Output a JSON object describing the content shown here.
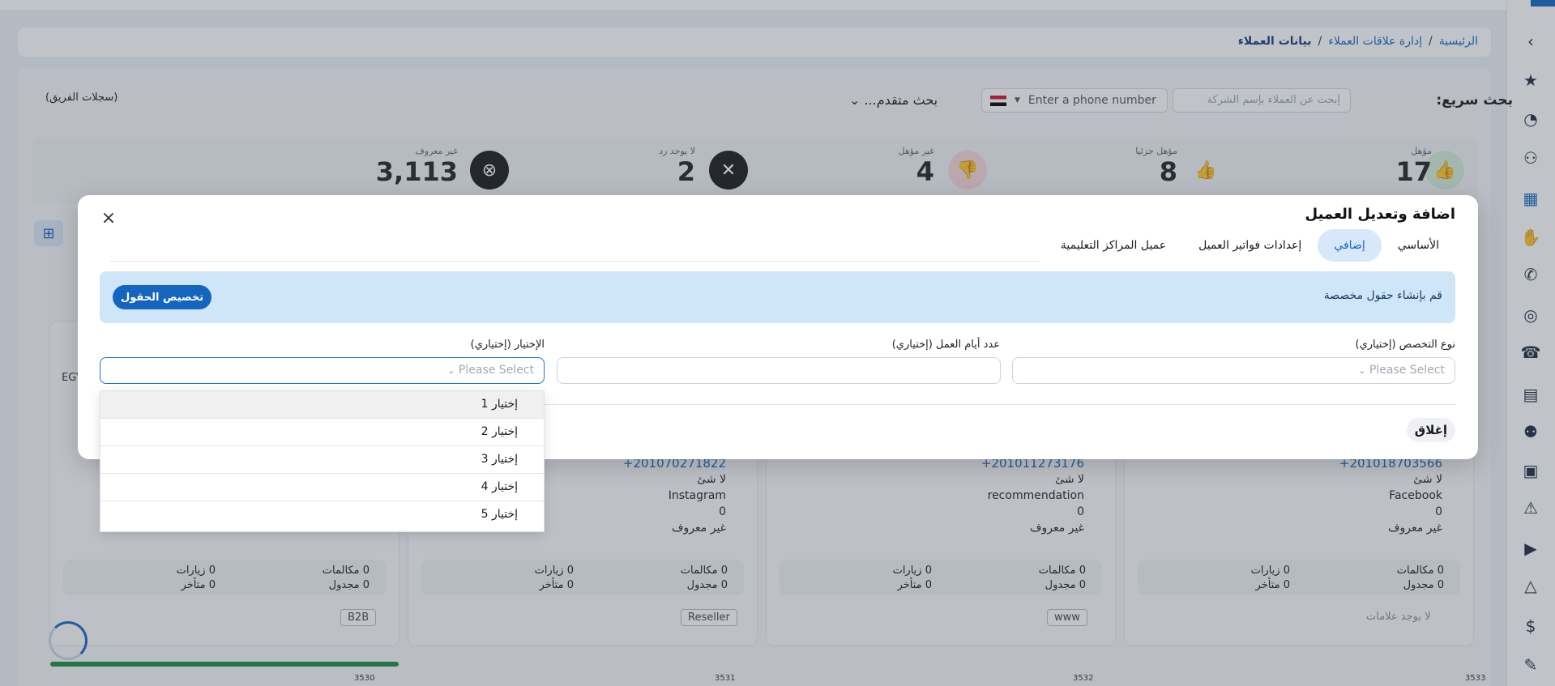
{
  "breadcrumb": {
    "home": "الرئيسية",
    "section": "إدارة علاقات العملاء",
    "current": "بيانات العملاء",
    "separator": "/"
  },
  "search": {
    "quick_label": "بحث سريع:",
    "company_placeholder": "إبحث عن العملاء بإسم الشركة",
    "phone_placeholder": "Enter a phone number",
    "advanced_label": "بحث متقدم...",
    "team_records": "(سجلات الفريق)"
  },
  "stats": [
    {
      "label": "مؤهل",
      "value": "17"
    },
    {
      "label": "مؤهل جزئيا",
      "value": "8"
    },
    {
      "label": "غير مؤهل",
      "value": "4"
    },
    {
      "label": "لا يوجد رد",
      "value": "2"
    },
    {
      "label": "غير معروف",
      "value": "3,113"
    }
  ],
  "cards": [
    {
      "phone": "201018703566+",
      "line1": "لا شئ",
      "source": "Facebook",
      "rating": "0",
      "status": "غير معروف",
      "calls_label": "مكالمات",
      "visits_label": "زيارات",
      "scheduled_label": "مجدول",
      "late_label": "متأخر",
      "calls": "0",
      "visits": "0",
      "scheduled": "0",
      "late": "0",
      "tag": "لا يوجد علامات",
      "id": "3533"
    },
    {
      "phone": "201011273176+",
      "line1": "لا شئ",
      "source": "recommendation",
      "rating": "0",
      "status": "غير معروف",
      "calls_label": "مكالمات",
      "visits_label": "زيارات",
      "scheduled_label": "مجدول",
      "late_label": "متأخر",
      "calls": "0",
      "visits": "0",
      "scheduled": "0",
      "late": "0",
      "tag": "www",
      "id": "3532"
    },
    {
      "phone": "201070271822+",
      "line1": "لا شئ",
      "source": "Instagram",
      "rating": "0",
      "status": "غير معروف",
      "calls_label": "مكالمات",
      "visits_label": "زيارات",
      "scheduled_label": "مجدول",
      "late_label": "متأخر",
      "calls": "0",
      "visits": "0",
      "scheduled": "0",
      "late": "0",
      "tag": "Reseller",
      "id": "3531"
    },
    {
      "phone": "",
      "line1": "",
      "source": "",
      "rating": "",
      "status": "",
      "calls_label": "مكالمات",
      "visits_label": "زيارات",
      "scheduled_label": "مجدول",
      "late_label": "متأخر",
      "calls": "0",
      "visits": "0",
      "scheduled": "0",
      "late": "0",
      "tag": "B2B",
      "id": "3530",
      "partial_text": "EGY"
    }
  ],
  "modal": {
    "title": "اضافة وتعديل العميل",
    "tabs": [
      {
        "label": "الأساسي",
        "active": false
      },
      {
        "label": "إضافي",
        "active": true
      },
      {
        "label": "إعدادات فواتير العميل",
        "active": false
      },
      {
        "label": "عميل المراكز التعليمية",
        "active": false
      }
    ],
    "info_text": "قم بإنشاء حقول مخصصة",
    "customize_label": "تخصيص الحقول",
    "fields": {
      "specialization": {
        "label": "نوع التخصص (إختياري)",
        "placeholder": "Please Select"
      },
      "work_days": {
        "label": "عدد أيام العمل (إختياري)",
        "value": ""
      },
      "choice": {
        "label": "الإختيار (إختياري)",
        "placeholder": "Please Select"
      }
    },
    "dropdown_options": [
      "إختيار 1",
      "إختيار 2",
      "إختيار 3",
      "إختيار 4",
      "إختيار 5"
    ],
    "close_label": "إغلاق"
  },
  "colors": {
    "primary": "#1565c0",
    "info_bg": "#cfe6f8",
    "tab_active_bg": "#d6e8fa"
  }
}
